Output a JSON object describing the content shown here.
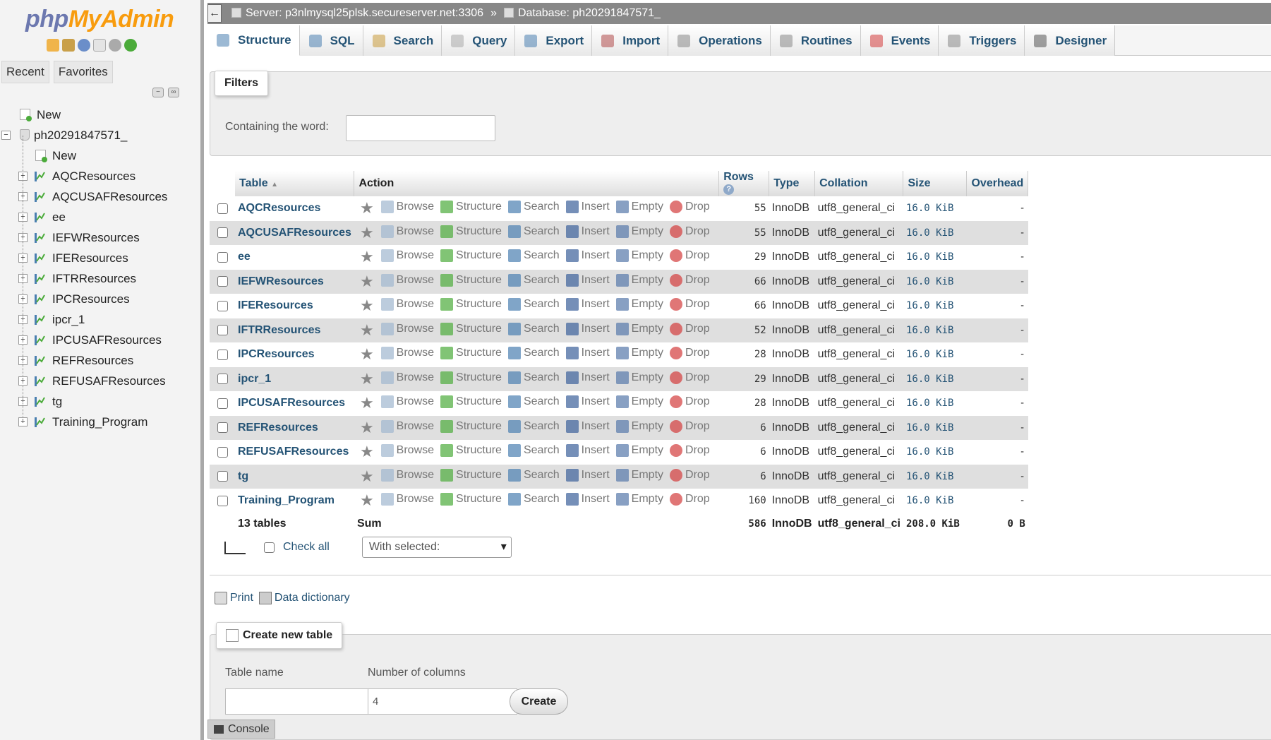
{
  "sidebar": {
    "logo": {
      "php": "php",
      "myadmin": "MyAdmin"
    },
    "tabs": [
      "Recent",
      "Favorites"
    ],
    "tree": {
      "top_new": "New",
      "database": "ph20291847571_",
      "db_new": "New",
      "tables": [
        "AQCResources",
        "AQCUSAFResources",
        "ee",
        "IEFWResources",
        "IFEResources",
        "IFTRResources",
        "IPCResources",
        "ipcr_1",
        "IPCUSAFResources",
        "REFResources",
        "REFUSAFResources",
        "tg",
        "Training_Program"
      ]
    }
  },
  "serverbar": {
    "back": "←",
    "server": "Server: p3nlmysql25plsk.secureserver.net:3306",
    "separator": "»",
    "database": "Database: ph20291847571_"
  },
  "tabs": [
    "Structure",
    "SQL",
    "Search",
    "Query",
    "Export",
    "Import",
    "Operations",
    "Routines",
    "Events",
    "Triggers",
    "Designer"
  ],
  "filters": {
    "legend": "Filters",
    "label": "Containing the word:",
    "value": ""
  },
  "table": {
    "headers": {
      "table": "Table",
      "sort": "▲",
      "action": "Action",
      "rows": "Rows",
      "help": "?",
      "type": "Type",
      "collation": "Collation",
      "size": "Size",
      "overhead": "Overhead"
    },
    "actions": {
      "browse": "Browse",
      "structure": "Structure",
      "search": "Search",
      "insert": "Insert",
      "empty": "Empty",
      "drop": "Drop"
    },
    "star": "★",
    "rows": [
      {
        "name": "AQCResources",
        "rows": "55",
        "type": "InnoDB",
        "collation": "utf8_general_ci",
        "size": "16.0 KiB",
        "overhead": "-"
      },
      {
        "name": "AQCUSAFResources",
        "rows": "55",
        "type": "InnoDB",
        "collation": "utf8_general_ci",
        "size": "16.0 KiB",
        "overhead": "-"
      },
      {
        "name": "ee",
        "rows": "29",
        "type": "InnoDB",
        "collation": "utf8_general_ci",
        "size": "16.0 KiB",
        "overhead": "-"
      },
      {
        "name": "IEFWResources",
        "rows": "66",
        "type": "InnoDB",
        "collation": "utf8_general_ci",
        "size": "16.0 KiB",
        "overhead": "-"
      },
      {
        "name": "IFEResources",
        "rows": "66",
        "type": "InnoDB",
        "collation": "utf8_general_ci",
        "size": "16.0 KiB",
        "overhead": "-"
      },
      {
        "name": "IFTRResources",
        "rows": "52",
        "type": "InnoDB",
        "collation": "utf8_general_ci",
        "size": "16.0 KiB",
        "overhead": "-"
      },
      {
        "name": "IPCResources",
        "rows": "28",
        "type": "InnoDB",
        "collation": "utf8_general_ci",
        "size": "16.0 KiB",
        "overhead": "-"
      },
      {
        "name": "ipcr_1",
        "rows": "29",
        "type": "InnoDB",
        "collation": "utf8_general_ci",
        "size": "16.0 KiB",
        "overhead": "-"
      },
      {
        "name": "IPCUSAFResources",
        "rows": "28",
        "type": "InnoDB",
        "collation": "utf8_general_ci",
        "size": "16.0 KiB",
        "overhead": "-"
      },
      {
        "name": "REFResources",
        "rows": "6",
        "type": "InnoDB",
        "collation": "utf8_general_ci",
        "size": "16.0 KiB",
        "overhead": "-"
      },
      {
        "name": "REFUSAFResources",
        "rows": "6",
        "type": "InnoDB",
        "collation": "utf8_general_ci",
        "size": "16.0 KiB",
        "overhead": "-"
      },
      {
        "name": "tg",
        "rows": "6",
        "type": "InnoDB",
        "collation": "utf8_general_ci",
        "size": "16.0 KiB",
        "overhead": "-"
      },
      {
        "name": "Training_Program",
        "rows": "160",
        "type": "InnoDB",
        "collation": "utf8_general_ci",
        "size": "16.0 KiB",
        "overhead": "-"
      }
    ],
    "summary": {
      "count": "13 tables",
      "label": "Sum",
      "rows": "586",
      "type": "InnoDB",
      "collation": "utf8_general_ci",
      "size": "208.0 KiB",
      "overhead": "0 B"
    }
  },
  "bulk": {
    "check_all": "Check all",
    "with_selected": "With selected:"
  },
  "links": {
    "print": "Print",
    "data_dictionary": "Data dictionary"
  },
  "create": {
    "legend": "Create new table",
    "table_name_label": "Table name",
    "table_name_value": "",
    "num_columns_label": "Number of columns",
    "num_columns_value": "4",
    "button": "Create"
  },
  "console": "Console",
  "colors": {
    "link": "#245375",
    "logo_php": "#6c78af",
    "logo_myadmin": "#f89c0e",
    "drop": "#d33c3c",
    "new": "#4bab3a"
  }
}
